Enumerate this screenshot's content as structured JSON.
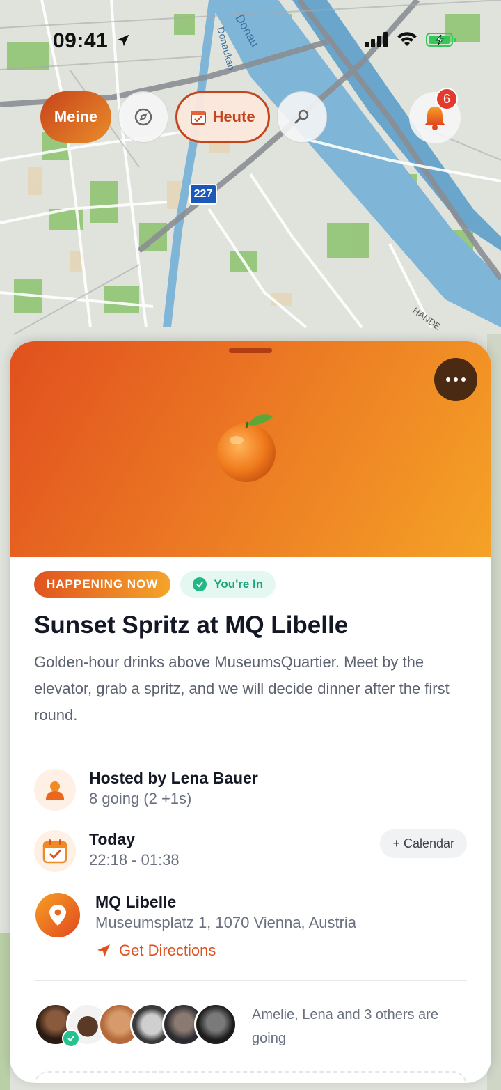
{
  "status_bar": {
    "time": "09:41"
  },
  "map": {
    "labels": [
      "Donau",
      "Donaukan",
      "HANDE"
    ],
    "route_shield": "227"
  },
  "top_bar": {
    "meine_label": "Meine",
    "heute_label": "Heute",
    "notification_count": "6"
  },
  "event": {
    "tag_happening": "HAPPENING NOW",
    "tag_in": "You're In",
    "title": "Sunset Spritz at MQ Libelle",
    "description": "Golden-hour drinks above MuseumsQuartier. Meet by the elevator, grab a spritz, and we will decide dinner after the first round.",
    "host_title": "Hosted by Lena Bauer",
    "host_sub": "8 going (2 +1s)",
    "date_title": "Today",
    "date_sub": "22:18 - 01:38",
    "calendar_button": "+ Calendar",
    "location_title": "MQ Libelle",
    "location_sub": "Museumsplatz 1, 1070 Vienna, Austria",
    "directions_label": "Get Directions",
    "going_summary": "Amelie, Lena and 3 others are going"
  },
  "colors": {
    "accent": "#e0501e",
    "success": "#22b886"
  }
}
